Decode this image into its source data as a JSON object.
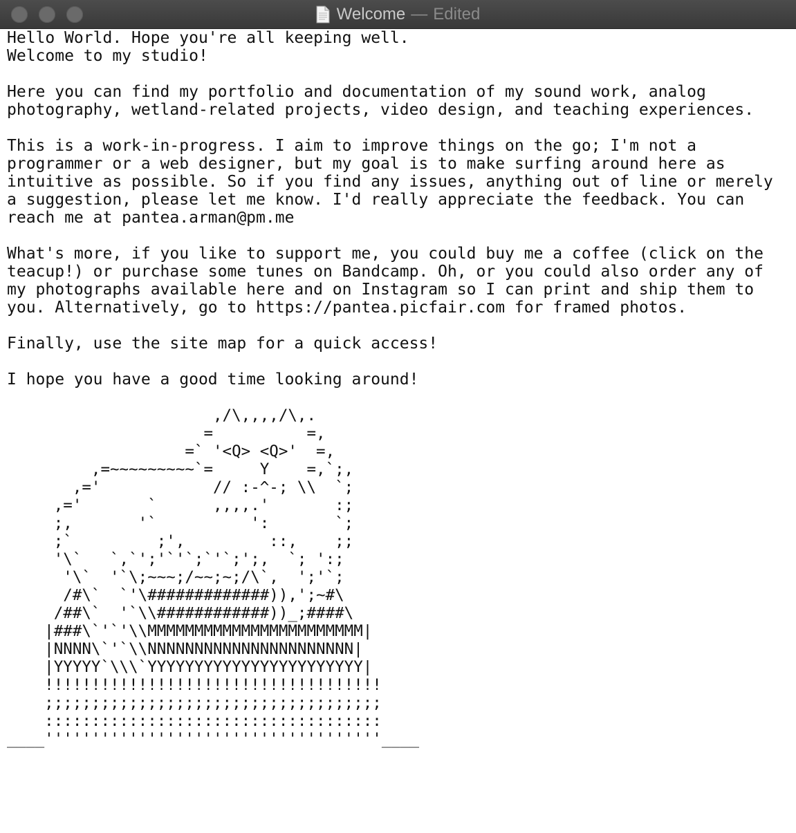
{
  "window": {
    "title": "Welcome",
    "separator": "—",
    "state": "Edited",
    "icon": "document-icon"
  },
  "document": {
    "body": "Hello World. Hope you're all keeping well.\nWelcome to my studio!\n\nHere you can find my portfolio and documentation of my sound work, analog\nphotography, wetland-related projects, video design, and teaching experiences.\n\nThis is a work-in-progress. I aim to improve things on the go; I'm not a\nprogrammer or a web designer, but my goal is to make surfing around here as\nintuitive as possible. So if you find any issues, anything out of line or merely\na suggestion, please let me know. I'd really appreciate the feedback. You can\nreach me at pantea.arman@pm.me\n\nWhat's more, if you like to support me, you could buy me a coffee (click on the\nteacup!) or purchase some tunes on Bandcamp. Oh, or you could also order any of\nmy photographs available here and on Instagram so I can print and ship them to\nyou. Alternatively, go to https://pantea.picfair.com for framed photos.\n\nFinally, use the site map for a quick access!\n\nI hope you have a good time looking around!\n\n",
    "ascii_art": "                      ,/\\,,,,/\\,.\n                     =          =,\n                   =` '<Q> <Q>'  =,\n         ,=~~~~~~~~~`=     Y    =,`;,\n       ,='            // :-^-; \\\\  `;\n     ,='       `      ,,,,.'       :;\n     ;,       '`          ':       `;\n     ;`         ;',         ::,    ;;\n     '\\`   `,`';'`'`;`'`;';,  `; ':;\n      '\\`  '`\\;~~~;/~~;~;/\\`,  ';'`;\n      /#\\`  `'\\#############)),';~#\\\n     /##\\`  '`\\\\############))_;####\\\n    |###\\`'`'\\\\MMMMMMMMMMMMMMMMMMMMMMM|\n    |NNNN\\`'`\\\\NNNNNNNNNNNNNNNNNNNNNN|\n    |YYYYY`\\\\\\`YYYYYYYYYYYYYYYYYYYYYYY|\n    !!!!!!!!!!!!!!!!!!!!!!!!!!!!!!!!!!!!\n    ;;;;;;;;;;;;;;;;;;;;;;;;;;;;;;;;;;;;\n    ::::::::::::::::::::::::::::::::::::\n____''''''''''''''''''''''''''''''''''''____"
  }
}
